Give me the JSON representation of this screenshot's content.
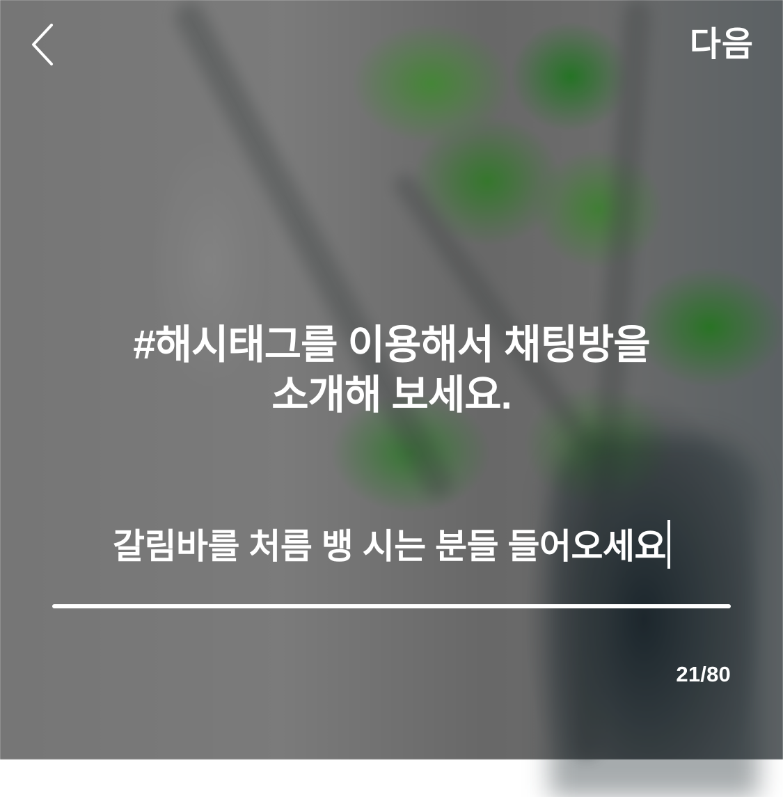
{
  "header": {
    "back_icon": "chevron-left-icon",
    "next_label": "다음"
  },
  "main": {
    "prompt_line_1": "#해시태그를 이용해서 채팅방을",
    "prompt_line_2": "소개해 보세요.",
    "input_value": "갈림바를 처름 뱅 시는 분들 들어오세요",
    "character_count": "21/80"
  },
  "colors": {
    "text": "#ffffff",
    "background_gray": "#7a7a7a",
    "leaf_green": "#2f7f2f",
    "vase_dark": "#1f2c33"
  }
}
